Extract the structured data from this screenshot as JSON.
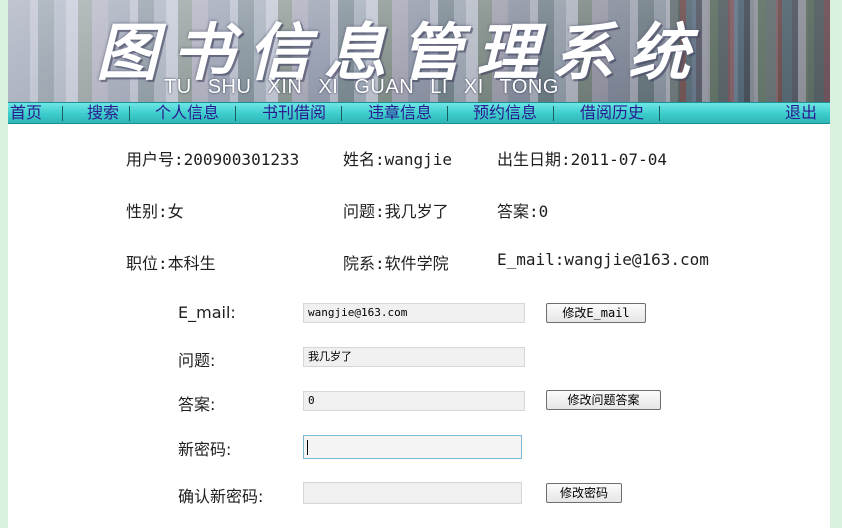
{
  "banner": {
    "title": "图书信息管理系统",
    "subtitle": "TU SHU XIN XI GUAN LI XI TONG"
  },
  "nav": {
    "items": [
      "首页",
      "搜索",
      "个人信息",
      "书刊借阅",
      "违章信息",
      "预约信息",
      "借阅历史"
    ],
    "logout": "退出"
  },
  "info": {
    "user_id": "用户号:200900301233",
    "name": "姓名:wangjie",
    "birth": "出生日期:2011-07-04",
    "gender": "性别:女",
    "question": "问题:我几岁了",
    "answer": "答案:0",
    "position": "职位:本科生",
    "department": "院系:软件学院",
    "email": "E_mail:wangjie@163.com"
  },
  "form": {
    "email_label": "E_mail:",
    "email_value": "wangjie@163.com",
    "email_button": "修改E_mail",
    "question_label": "问题:",
    "question_value": "我几岁了",
    "answer_label": "答案:",
    "answer_value": "0",
    "answer_button": "修改问题答案",
    "new_password_label": "新密码:",
    "new_password_value": "",
    "confirm_password_label": "确认新密码:",
    "confirm_password_value": "",
    "password_button": "修改密码"
  }
}
